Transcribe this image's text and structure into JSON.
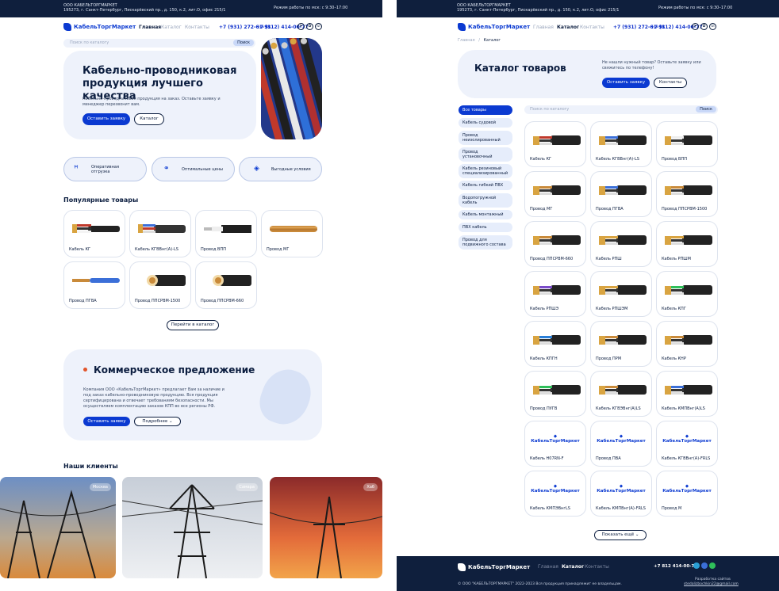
{
  "company": {
    "name": "ООО КАБЕЛЬТОРГМАРКЕТ",
    "address": "195273, г. Санкт-Петербург, Пискарёвский пр., д. 150, к.2, лит.О, офис 215/1",
    "hours": "Режим работы по мск: с 9:30–17:00"
  },
  "brand": "КабельТоргМаркет",
  "nav": {
    "home": "Главная",
    "catalog": "Каталог",
    "contacts": "Контакты"
  },
  "phones": {
    "mobile": "+7 (931) 272-61-91",
    "city": "+7 (812) 414-00-77",
    "footer": "+7 812 414-00-77"
  },
  "search": {
    "placeholder": "Поиск по каталогу",
    "button": "Поиск"
  },
  "hero": {
    "title_line1": "Кабельно-проводниковая",
    "title_line2": "продукция лучшего качества",
    "text_line1": "Кабельно-проводниковая продукция на заказ. Оставьте заявку и",
    "text_line2": "менеджер перезвонит вам.",
    "cta": "Оставить заявку",
    "catalog": "Каталог"
  },
  "features": [
    "Оперативная отгрузка",
    "Оптимальные цены",
    "Выгодные условия"
  ],
  "popular": {
    "title": "Популярные товары",
    "goto": "Перейти в каталог",
    "items": [
      "Кабель КГ",
      "Кабель КГВВнг(А)-LS",
      "Провод ВПП",
      "Провод МГ",
      "Провод ПГВА",
      "Провод ППСРВМ-1500",
      "Провод ППСРВМ-660"
    ]
  },
  "offer": {
    "title": "Коммерческое предложение",
    "text_line1": "Компания ООО «КабельТоргМаркет» предлагает Вам за наличие и",
    "text_line2": "под заказ кабельно-проводниковую продукцию. Вся продукция",
    "text_line3": "сертифицирована и отвечает требованиям безопасности. Мы",
    "text_line4": "осуществляем комплектацию заказов КПП во все регионы РФ.",
    "cta": "Оставить заявку",
    "more": "Подробнее"
  },
  "clients": {
    "title": "Наши клиенты",
    "cities": [
      "Москва",
      "Самара",
      "Хаб"
    ]
  },
  "breadcrumb": {
    "home": "Главная",
    "sep": "/",
    "current": "Каталог"
  },
  "catalog": {
    "title": "Каталог товаров",
    "note_line1": "Не нашли нужный товар? Оставьте заявку или",
    "note_line2": "свяжитесь по телефону!",
    "cta": "Оставить заявку",
    "contacts": "Контакты",
    "categories": [
      "Все товары",
      "Кабель судовой",
      "Провод неизолированный",
      "Провод установочный",
      "Кабель резиновый специализированный",
      "Кабель гибкий ПВХ",
      "Водопогружной кабель",
      "Кабель монтажный",
      "ПВХ кабель",
      "Провод для подвижного состава"
    ],
    "products": [
      "Кабель КГ",
      "Кабель КГВВнг(А)-LS",
      "Провод ВПП",
      "Провод МГ",
      "Провод ПГВА",
      "Провод ППСРВМ-1500",
      "Провод ППСРВМ-660",
      "Кабель РПШ",
      "Кабель РПШМ",
      "Кабель РПШЭ",
      "Кабель РПШЭМ",
      "Кабель КПГ",
      "Кабель КПГН",
      "Провод ПРМ",
      "Кабель КНР",
      "Провод ПУГВ",
      "Кабель КГВЭВнг(А)LS",
      "Кабель КМПВнг(А)LS",
      "Кабель H07RN-F",
      "Провод ПВА",
      "Кабель КГВВнг(А)-FRLS",
      "Кабель КМПЭВнгLS",
      "Кабель КМПВнг(А)-FRLS",
      "Провод М"
    ],
    "more": "Показать ещё"
  },
  "footer": {
    "copyright": "© ООО \"КАБЕЛЬТОРГМАРКЕТ\" 2022-2023 Вся продукция принадлежит ее владельцам.",
    "dev": "Разработка сайтов",
    "email": "stedalizbochkin22@gmail.com"
  },
  "colors": {
    "navy": "#0f1f3d",
    "accent": "#0b3ad1",
    "light": "#eef2fb"
  }
}
